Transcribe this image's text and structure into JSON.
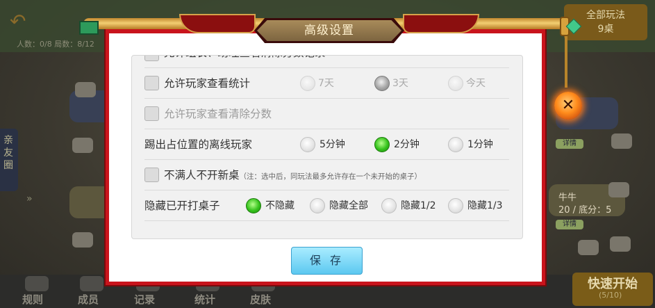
{
  "background": {
    "stats_text": "人数：0/8  局数：8/12",
    "side_tab": "亲友圈",
    "right_panel": [
      "全部玩法",
      "9桌"
    ],
    "right_table_text": [
      "牛牛",
      "20 / 底分：5"
    ],
    "detail_label": "详情",
    "bottom_tabs": [
      "规则",
      "成员",
      "记录",
      "统计",
      "皮肤"
    ],
    "quick_start": "快速开始",
    "quick_start_sub": "(5/10)"
  },
  "dialog": {
    "title": "高级设置",
    "close_icon": "close-icon",
    "rows": [
      {
        "label": "允许组长、助理查看清除分数记录",
        "checked": false,
        "disabled": false
      },
      {
        "label": "允许玩家查看统计",
        "checked": false,
        "disabled": false,
        "options": [
          {
            "label": "7天",
            "selected": false
          },
          {
            "label": "3天",
            "selected": true
          },
          {
            "label": "今天",
            "selected": false
          }
        ]
      },
      {
        "label": "允许玩家查看清除分数",
        "checked": false,
        "disabled": true
      },
      {
        "label": "踢出占位置的离线玩家",
        "options": [
          {
            "label": "5分钟",
            "selected": false
          },
          {
            "label": "2分钟",
            "selected": true
          },
          {
            "label": "1分钟",
            "selected": false
          }
        ]
      },
      {
        "label": "不满人不开新桌",
        "checked": false,
        "disabled": false,
        "note": "（注：选中后，同玩法最多允许存在一个未开始的桌子）"
      },
      {
        "label": "隐藏已开打桌子",
        "options": [
          {
            "label": "不隐藏",
            "selected": true
          },
          {
            "label": "隐藏全部",
            "selected": false
          },
          {
            "label": "隐藏1/2",
            "selected": false
          },
          {
            "label": "隐藏1/3",
            "selected": false
          }
        ]
      }
    ],
    "save_label": "保 存"
  },
  "colors": {
    "frame_red": "#c9141c",
    "selected_green": "#35c21c",
    "save_blue": "#5cc8f0"
  }
}
